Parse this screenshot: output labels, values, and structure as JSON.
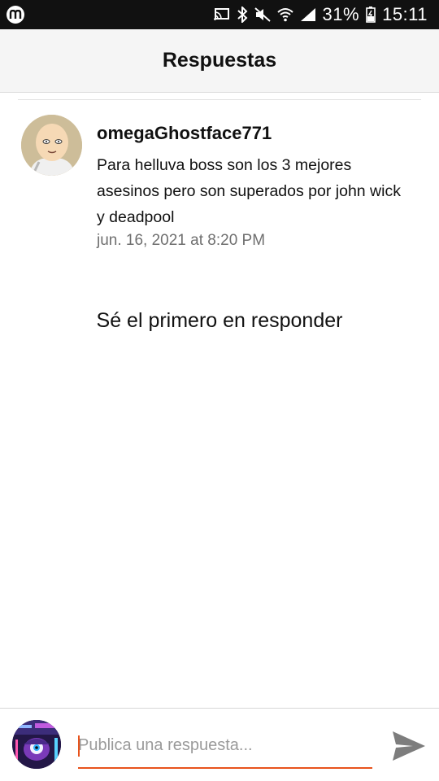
{
  "status_bar": {
    "battery_percent": "31%",
    "time": "15:11",
    "icons": [
      "app-badge-icon",
      "cast-icon",
      "bluetooth-icon",
      "mute-icon",
      "wifi-icon",
      "signal-icon",
      "battery-icon"
    ]
  },
  "header": {
    "title": "Respuestas"
  },
  "comment": {
    "username": "omegaGhostface771",
    "text": "Para helluva boss son los 3 mejores asesinos pero son superados por john wick y deadpool",
    "timestamp": "jun. 16, 2021 at 8:20 PM"
  },
  "replies": {
    "empty_message": "Sé el primero en responder"
  },
  "composer": {
    "placeholder": "Publica una respuesta...",
    "value": "",
    "accent_color": "#e8531c"
  }
}
